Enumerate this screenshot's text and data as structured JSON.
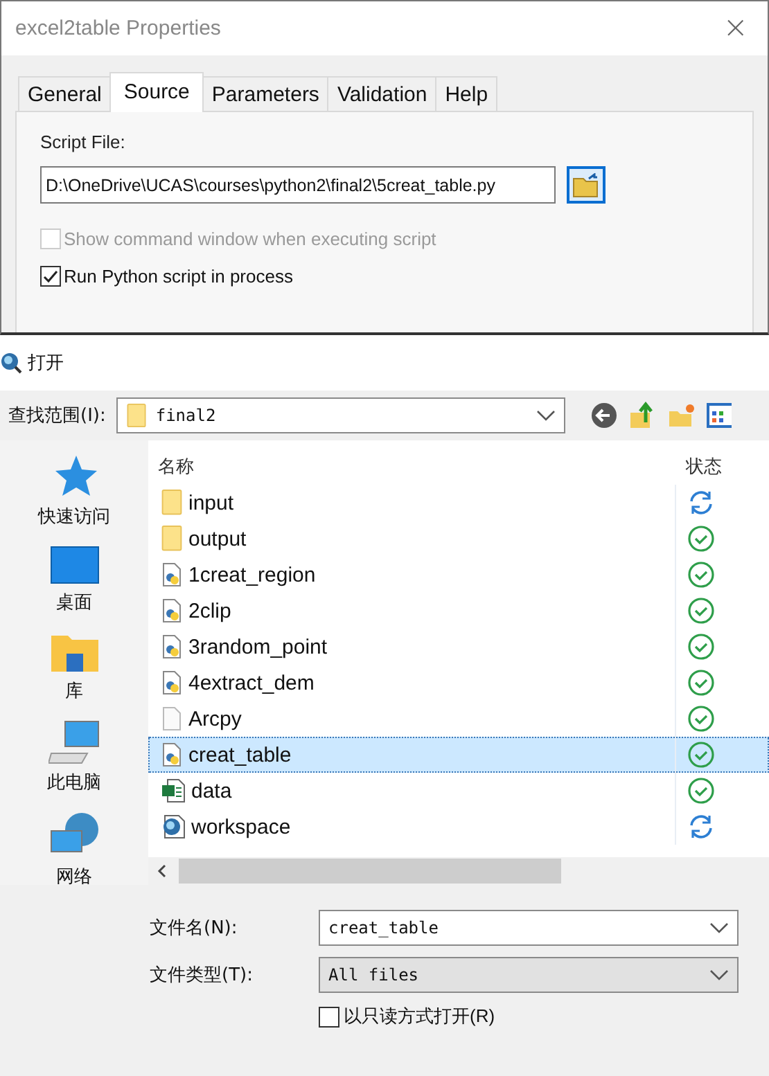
{
  "properties_window": {
    "title": "excel2table Properties",
    "close": "×",
    "tabs": [
      {
        "label": "General",
        "selected": false
      },
      {
        "label": "Source",
        "selected": true
      },
      {
        "label": "Parameters",
        "selected": false
      },
      {
        "label": "Validation",
        "selected": false
      },
      {
        "label": "Help",
        "selected": false
      }
    ],
    "script_file_label": "Script File:",
    "script_file": "D:\\OneDrive\\UCAS\\courses\\python2\\final2\\5creat_table.py",
    "options": [
      {
        "label": "Show command window when executing script",
        "checked": false,
        "disabled": true
      },
      {
        "label": "Run Python script in process",
        "checked": true,
        "disabled": false
      }
    ]
  },
  "open_dialog": {
    "title": "打开",
    "look_in_label": "查找范围(I):",
    "look_in": "final2",
    "places": [
      {
        "kind": "star",
        "label": "快速访问"
      },
      {
        "kind": "desktop",
        "label": "桌面"
      },
      {
        "kind": "library",
        "label": "库"
      },
      {
        "kind": "computer",
        "label": "此电脑"
      },
      {
        "kind": "network",
        "label": "网络"
      }
    ],
    "columns": [
      "名称",
      "状态"
    ],
    "files": [
      {
        "kind": "folder",
        "name": "input",
        "status": {
          "kind": "sync"
        },
        "selected": false
      },
      {
        "kind": "folder",
        "name": "output",
        "status": {
          "kind": "ok"
        },
        "selected": false
      },
      {
        "kind": "python",
        "name": "1creat_region",
        "status": {
          "kind": "ok"
        },
        "selected": false
      },
      {
        "kind": "python",
        "name": "2clip",
        "status": {
          "kind": "ok"
        },
        "selected": false
      },
      {
        "kind": "python",
        "name": "3random_point",
        "status": {
          "kind": "ok"
        },
        "selected": false
      },
      {
        "kind": "python",
        "name": "4extract_dem",
        "status": {
          "kind": "ok"
        },
        "selected": false
      },
      {
        "kind": "generic",
        "name": "Arcpy",
        "status": {
          "kind": "ok"
        },
        "selected": false
      },
      {
        "kind": "python",
        "name": "creat_table",
        "status": {
          "kind": "ok"
        },
        "selected": true
      },
      {
        "kind": "excel",
        "name": "data",
        "status": {
          "kind": "ok"
        },
        "selected": false
      },
      {
        "kind": "workspace",
        "name": "workspace",
        "status": {
          "kind": "sync"
        },
        "selected": false
      }
    ],
    "file_name_label": "文件名(N):",
    "file_name": "creat_table",
    "file_type_label": "文件类型(T):",
    "file_type": "All files",
    "read_only": {
      "label": "以只读方式打开(R)",
      "checked": false
    }
  }
}
